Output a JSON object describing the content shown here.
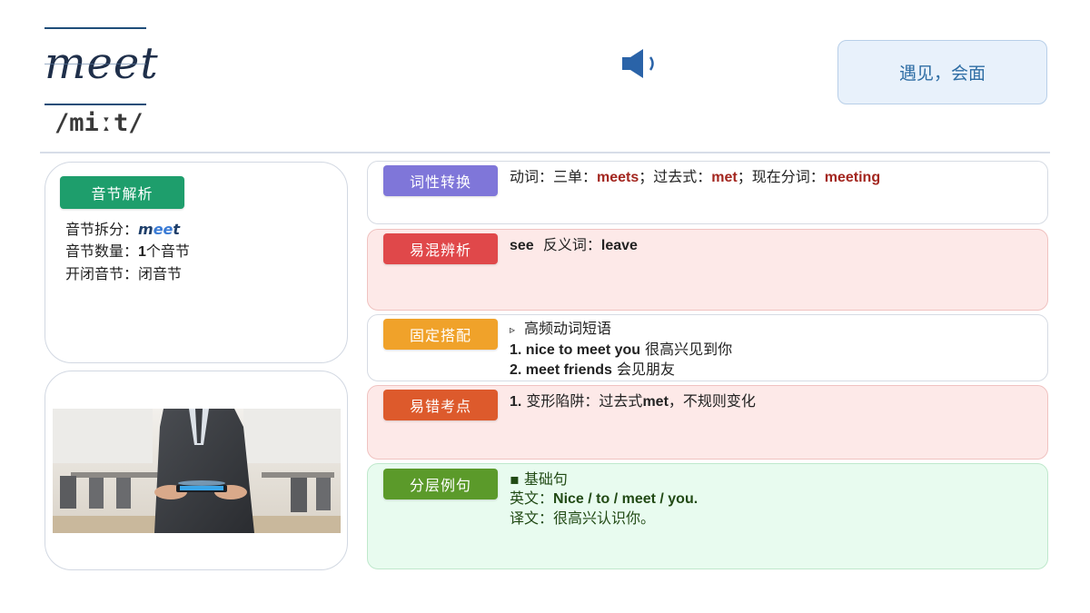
{
  "header": {
    "word": "meet",
    "phonetic": "/miːt/",
    "meaning": "遇见，会面"
  },
  "syllable_card": {
    "tag": "音节解析",
    "split_label": "音节拆分：",
    "split_value_1": "m",
    "split_value_2": "ee",
    "split_value_3": "t",
    "count_label": "音节数量：",
    "count_number": "1",
    "count_unit": "个音节",
    "open_close_label": "开闭音节：",
    "open_close_value": "闭音节"
  },
  "rows": {
    "pos": {
      "tag": "词性转换",
      "label_1": "动词：三单：",
      "value_1": "meets",
      "label_2": "；过去式：",
      "value_2": "met",
      "label_3": "；现在分词：",
      "value_3": "meeting"
    },
    "confusion": {
      "tag": "易混辨析",
      "word": "see",
      "label": "  反义词：",
      "antonym": "leave"
    },
    "collocation": {
      "tag": "固定搭配",
      "bullet": "▹",
      "heading": "高频动词短语",
      "item_1_en": "1. nice to meet you",
      "item_1_cn": " 很高兴见到你",
      "item_2_en": "2. meet friends",
      "item_2_cn": " 会见朋友"
    },
    "pitfall": {
      "tag": "易错考点",
      "num": "1.",
      "text_1": " 变形陷阱：过去式",
      "word": "met",
      "text_2": "，不规则变化"
    },
    "examples": {
      "tag": "分层例句",
      "level": "▪ 基础句",
      "en_label": "英文：",
      "en_text": "Nice / to / meet / you.",
      "cn_label": "译文：",
      "cn_text": "很高兴认识你。"
    }
  },
  "colors": {
    "syllable_tag": "#1e9e6c",
    "pos_tag": "#7f76d9",
    "confusion_tag": "#e0484a",
    "collocation_tag": "#f0a22a",
    "pitfall_tag": "#dd5a2c",
    "examples_tag": "#5b9a2a",
    "meaning_text": "#2e6da4"
  },
  "icons": {
    "audio": "speaker-icon"
  }
}
